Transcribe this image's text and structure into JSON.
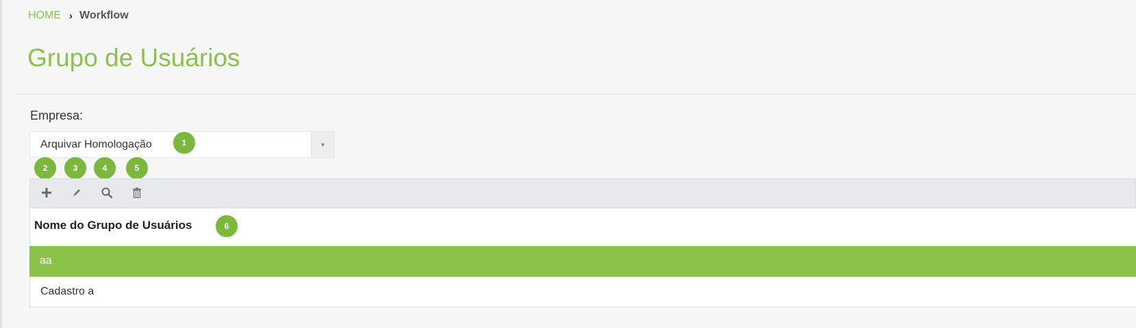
{
  "breadcrumb": {
    "home": "HOME",
    "separator": "›",
    "current": "Workflow"
  },
  "page": {
    "title": "Grupo de Usuários"
  },
  "company": {
    "label": "Empresa:",
    "selected": "Arquivar Homologação"
  },
  "toolbar": {
    "icons": [
      "plus-icon",
      "pencil-icon",
      "search-icon",
      "trash-icon"
    ]
  },
  "grid": {
    "column_header": "Nome do Grupo de Usuários",
    "rows": [
      "aa",
      "Cadastro a"
    ]
  },
  "markers": [
    "1",
    "2",
    "3",
    "4",
    "5",
    "6"
  ],
  "colors": {
    "accent": "#8bc34a",
    "marker": "#7db83e"
  }
}
